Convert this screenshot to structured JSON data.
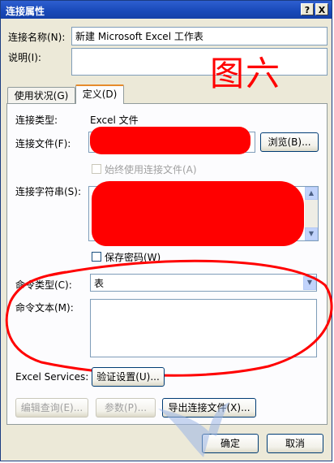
{
  "window": {
    "title": "连接属性",
    "help_btn": "?",
    "close_btn": "X"
  },
  "connection_name": {
    "label": "连接名称(N):",
    "value": "新建 Microsoft Excel 工作表"
  },
  "description": {
    "label": "说明(I):",
    "value": ""
  },
  "annotation": "图六",
  "tabs": [
    {
      "label": "使用状况(G)",
      "active": false
    },
    {
      "label": "定义(D)",
      "active": true
    }
  ],
  "definition": {
    "connection_type_label": "连接类型:",
    "connection_type_value": "Excel 文件",
    "connection_file_label": "连接文件(F):",
    "browse_button": "浏览(B)...",
    "always_use_file_label": "始终使用连接文件(A)",
    "connection_string_label": "连接字符串(S):",
    "save_password_label": "保存密码(W)",
    "command_type_label": "命令类型(C):",
    "command_type_value": "表",
    "command_text_label": "命令文本(M):",
    "command_text_value": "",
    "excel_services_label": "Excel Services:",
    "auth_settings_button": "验证设置(U)...",
    "edit_query_button": "编辑查询(E)...",
    "parameters_button": "参数(P)...",
    "export_button": "导出连接文件(X)..."
  },
  "footer": {
    "ok_button": "确定",
    "cancel_button": "取消"
  },
  "colors": {
    "title_bar": "#1848b8",
    "dialog_bg": "#ece9d8",
    "annotation_red": "#ff0000"
  }
}
